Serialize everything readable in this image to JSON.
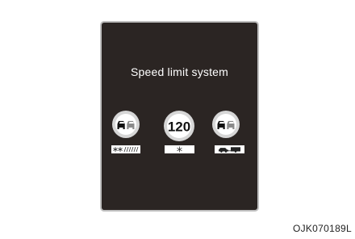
{
  "display": {
    "title": "Speed limit system"
  },
  "signs": {
    "left": {
      "icon": "no-overtaking-sign-icon",
      "plate_icon": "snow-rain-condition-icon"
    },
    "middle": {
      "speed_limit": "120",
      "plate_icon": "snowflake-icon"
    },
    "right": {
      "icon": "no-overtaking-sign-icon",
      "plate_icon": "car-with-trailer-icon"
    }
  },
  "caption": "OJK070189L",
  "colors": {
    "panel_background": "#2b2523",
    "panel_border": "#bfbfbf",
    "sign_ring": "#d6d6d6",
    "sign_face": "#ffffff",
    "car_left": "#111111",
    "car_right": "#8a8a8a"
  }
}
